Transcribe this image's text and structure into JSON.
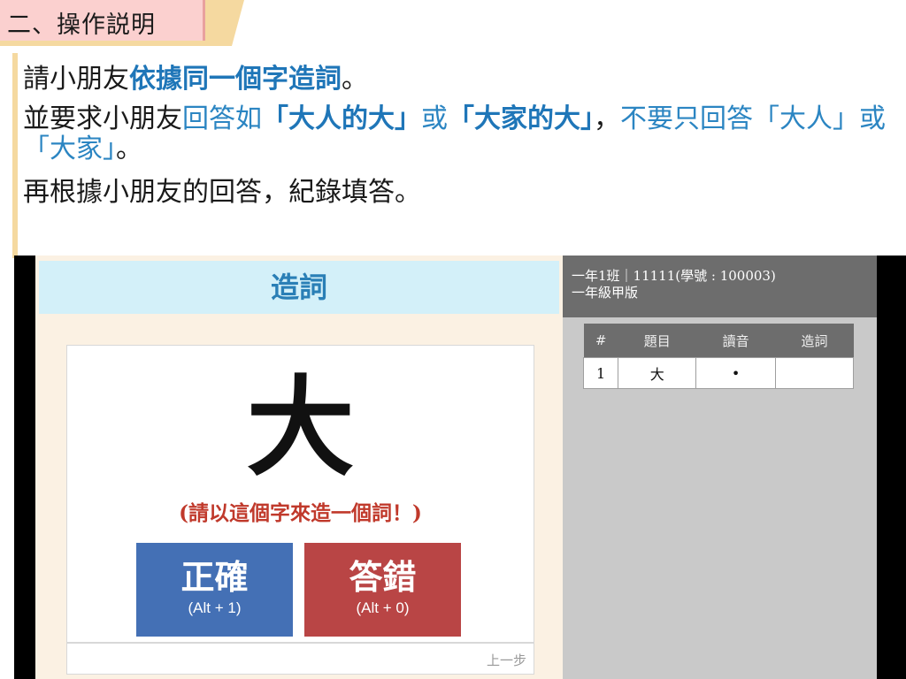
{
  "heading": {
    "title": "二、操作説明"
  },
  "instructions": {
    "line1_prefix": "請小朋友",
    "line1_highlight": "依據同一個字造詞",
    "line1_suffix": "。",
    "line2_part1": "並要求小朋友",
    "line2_part2": "回答如",
    "line2_part3": "「大人的大」",
    "line2_part4": "或",
    "line2_part5": "「大家的大」",
    "line2_part6": "，",
    "line2_part7": "不要只回答「大人」或「大家」",
    "line2_part8": "。",
    "line3": "再根據小朋友的回答，紀錄填答。"
  },
  "app": {
    "title": "造詞",
    "character": "大",
    "prompt": "(請以這個字來造一個詞！)",
    "correct_button": {
      "label": "正確",
      "shortcut": "(Alt + 1)",
      "color": "#4470b5"
    },
    "wrong_button": {
      "label": "答錯",
      "shortcut": "(Alt + 0)",
      "color": "#b94545"
    },
    "prev_link": "上一步",
    "info_line1": "一年1班｜11111(學號 : 100003)",
    "info_line2": "一年級甲版",
    "table": {
      "headers": [
        "#",
        "題目",
        "讀音",
        "造詞"
      ],
      "rows": [
        {
          "num": "1",
          "question": "大",
          "reading": "•",
          "word": ""
        }
      ]
    }
  }
}
